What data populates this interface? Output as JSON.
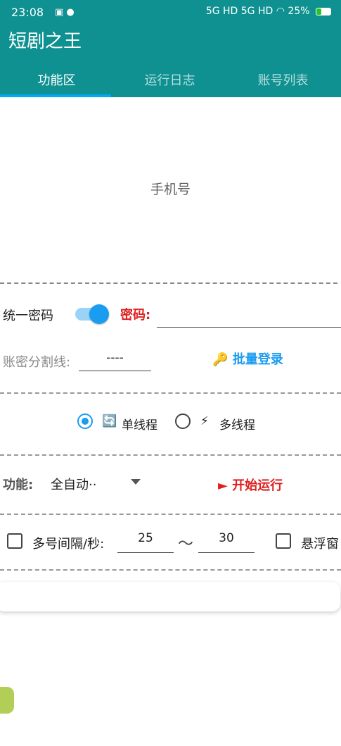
{
  "status_bar": {
    "time": "23:08",
    "network": "5G HD 5G HD",
    "battery": "25%"
  },
  "app": {
    "title": "短剧之王"
  },
  "tabs": [
    {
      "label": "功能区",
      "active": true
    },
    {
      "label": "运行日志",
      "active": false
    },
    {
      "label": "账号列表",
      "active": false
    }
  ],
  "form": {
    "phone_placeholder": "手机号",
    "unified_password_label": "统一密码",
    "unified_password_on": true,
    "password_label": "密码:",
    "separator_label": "账密分割线:",
    "separator_value": "----",
    "batch_login_label": "批量登录",
    "thread_mode": {
      "single_label": "单线程",
      "multi_label": "多线程",
      "selected": "single"
    },
    "function_label": "功能:",
    "function_value": "全自动··",
    "start_label": "开始运行",
    "interval_label": "多号间隔/秒:",
    "interval_min": "25",
    "interval_max": "30",
    "tilde": "～",
    "float_window_label": "悬浮窗"
  },
  "icons": {
    "batch_login": "key-icon",
    "single_thread": "refresh-icon",
    "multi_thread": "lightning-icon",
    "start": "play-icon"
  },
  "colors": {
    "header": "#0f9191",
    "accent": "#1a9cf0",
    "danger": "#e02020"
  }
}
